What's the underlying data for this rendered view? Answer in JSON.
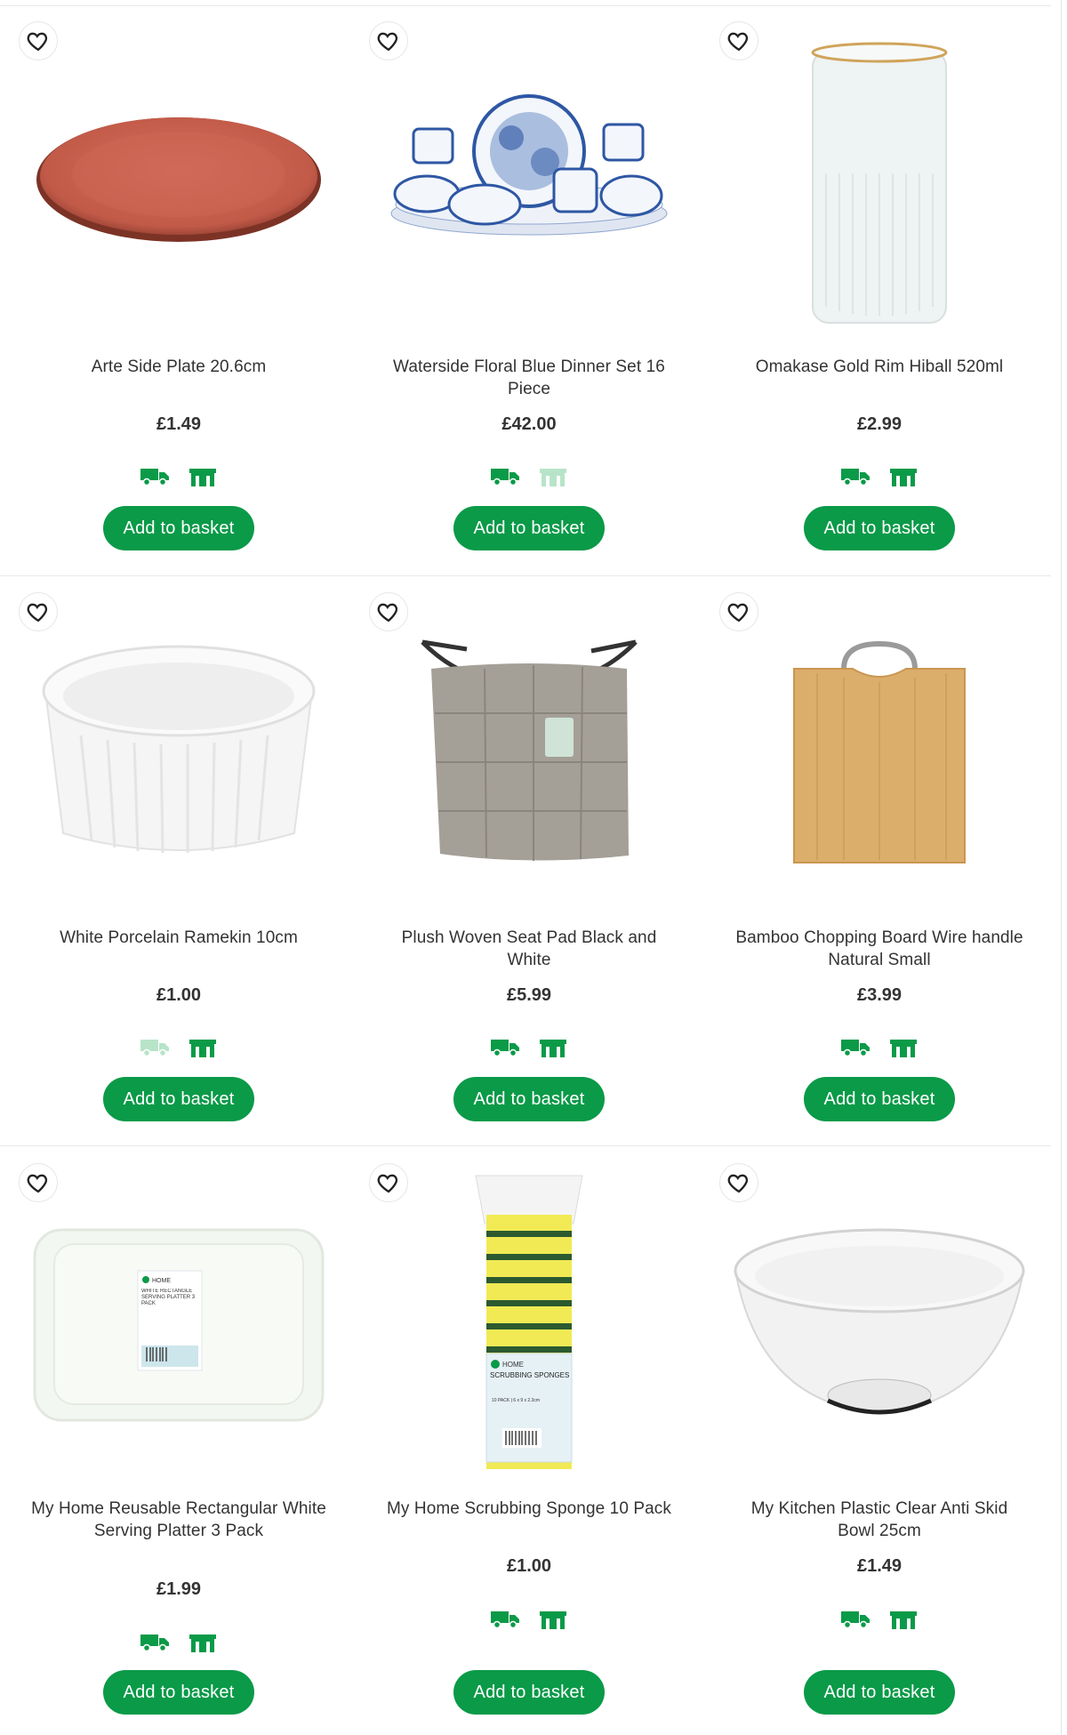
{
  "products": [
    {
      "name": "Arte Side Plate 20.6cm",
      "price": "£1.49",
      "button": "Add to basket",
      "delivery": true,
      "collect": true
    },
    {
      "name": "Waterside Floral Blue Dinner Set 16 Piece",
      "price": "£42.00",
      "button": "Add to basket",
      "delivery": true,
      "collect": false
    },
    {
      "name": "Omakase Gold Rim Hiball 520ml",
      "price": "£2.99",
      "button": "Add to basket",
      "delivery": true,
      "collect": true
    },
    {
      "name": "White Porcelain Ramekin 10cm",
      "price": "£1.00",
      "button": "Add to basket",
      "delivery": false,
      "collect": true
    },
    {
      "name": "Plush Woven Seat Pad Black and White",
      "price": "£5.99",
      "button": "Add to basket",
      "delivery": true,
      "collect": true
    },
    {
      "name": "Bamboo Chopping Board Wire handle Natural Small",
      "price": "£3.99",
      "button": "Add to basket",
      "delivery": true,
      "collect": true
    },
    {
      "name": "My Home Reusable Rectangular White Serving Platter 3 Pack",
      "price": "£1.99",
      "button": "Add to basket",
      "delivery": true,
      "collect": true
    },
    {
      "name": "My Home Scrubbing Sponge 10 Pack",
      "price": "£1.00",
      "button": "Add to basket",
      "delivery": true,
      "collect": true
    },
    {
      "name": "My Kitchen Plastic Clear Anti Skid Bowl 25cm",
      "price": "£1.49",
      "button": "Add to basket",
      "delivery": true,
      "collect": true
    }
  ],
  "packaging": {
    "platter_brand": "HOME",
    "platter_label": "WHITE RECTANGLE SERVING PLATTER 3 PACK",
    "sponge_brand": "HOME",
    "sponge_label": "SCRUBBING SPONGES",
    "sponge_size": "10 PACK | 6 x 9 x 2.3cm"
  },
  "colors": {
    "accent_green": "#0a9a48",
    "badge_inactive": "#b7e4c9"
  }
}
